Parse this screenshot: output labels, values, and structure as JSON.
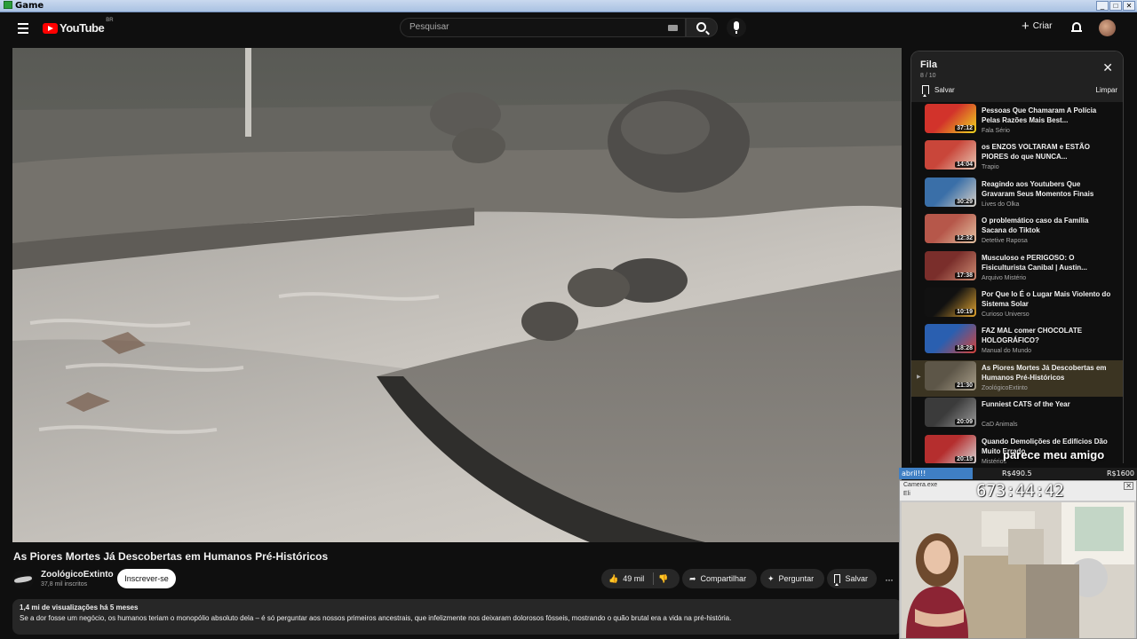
{
  "window": {
    "title": "Game",
    "controls": [
      "_",
      "□",
      "✕"
    ]
  },
  "header": {
    "logo_text": "YouTube",
    "country_code": "BR",
    "search_placeholder": "Pesquisar",
    "create_label": "Criar"
  },
  "video": {
    "title": "As Piores Mortes Já Descobertas em Humanos Pré-Históricos",
    "channel": "ZoológicoExtinto",
    "subscribers": "37,8 mil inscritos",
    "subscribe_label": "Inscrever-se",
    "likes": "49 mil",
    "share_label": "Compartilhar",
    "ask_label": "Perguntar",
    "save_label": "Salvar",
    "more_label": "···",
    "meta": "1,4 mi de visualizações  há 5 meses",
    "description": "Se a dor fosse um negócio, os humanos teriam o monopólio absoluto dela – é só perguntar aos nossos primeiros ancestrais, que infelizmente nos deixaram dolorosos fósseis, mostrando o quão brutal era a vida na pré-história."
  },
  "queue": {
    "title": "Fila",
    "count": "8 / 10",
    "save_label": "Salvar",
    "clear_label": "Limpar",
    "close_label": "✕",
    "active_indicator": "▶",
    "items": [
      {
        "title": "Pessoas Que Chamaram A Polícia Pelas Razões Mais Best...",
        "channel": "Fala Sério",
        "duration": "37:12",
        "colors": [
          "#d2332b",
          "#f0d81f"
        ]
      },
      {
        "title": "os ENZOS VOLTARAM e ESTÃO PIORES do que NUNCA...",
        "channel": "Trapio",
        "duration": "14:04",
        "colors": [
          "#c9463a",
          "#e7c8b4"
        ]
      },
      {
        "title": "Reagindo aos Youtubers Que Gravaram Seus Momentos Finais",
        "channel": "Lives do Olka",
        "duration": "30:29",
        "colors": [
          "#3a6fa8",
          "#d9d2c7"
        ]
      },
      {
        "title": "O problemático caso da Família Sacana do Tiktok",
        "channel": "Detetive Raposa",
        "duration": "12:32",
        "colors": [
          "#b6574a",
          "#e4c3a3"
        ]
      },
      {
        "title": "Musculoso e PERIGOSO: O Fisiculturista Canibal | Austin...",
        "channel": "Arquivo Mistério",
        "duration": "17:38",
        "colors": [
          "#7a2e2b",
          "#cf8e74"
        ]
      },
      {
        "title": "Por Que Io É o Lugar Mais Violento do Sistema Solar",
        "channel": "Curioso Universo",
        "duration": "10:19",
        "colors": [
          "#111111",
          "#e1a431"
        ]
      },
      {
        "title": "FAZ MAL comer CHOCOLATE HOLOGRÁFICO?",
        "channel": "Manual do Mundo",
        "duration": "18:28",
        "colors": [
          "#2a5fb0",
          "#d8433a"
        ]
      },
      {
        "title": "As Piores Mortes Já Descobertas em Humanos Pré-Históricos",
        "channel": "ZoológicoExtinto",
        "duration": "21:30",
        "colors": [
          "#5d5648",
          "#a99f8a"
        ],
        "active": true
      },
      {
        "title": "Funniest CATS of the Year",
        "channel": "CaD Animals",
        "duration": "20:09",
        "colors": [
          "#3b3b3b",
          "#9a9a9a"
        ]
      },
      {
        "title": "Quando Demolições de Edifícios Dão Muito Errado",
        "channel": "Mistérios",
        "duration": "20:15",
        "colors": [
          "#b52e2e",
          "#d9d9d9"
        ]
      }
    ]
  },
  "overlay": {
    "chat_text": "parece meu amigo",
    "bar_left": "abril!!!",
    "bar_mid": "R$490.5",
    "bar_right": "R$1600",
    "progress_fraction": 0.31,
    "camera_name": "Camera.exe",
    "camera_sub": "Eli",
    "timer": "673:44:42",
    "camera_close": "✕"
  }
}
